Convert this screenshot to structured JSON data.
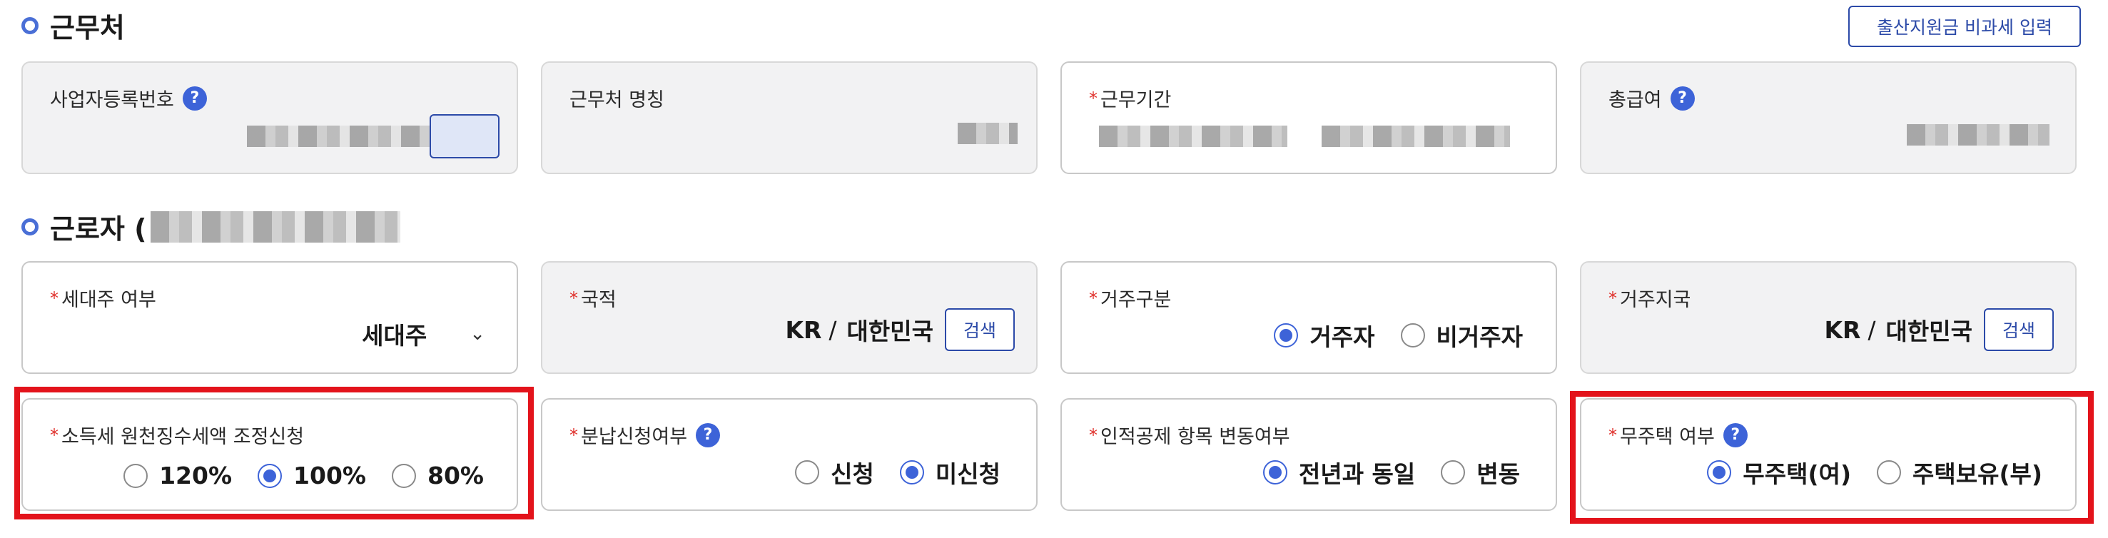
{
  "sections": {
    "workplace_title": "근무처",
    "worker_title": "근로자 ("
  },
  "top_button": "출산지원금 비과세 입력",
  "workplace": {
    "biz_no_label": "사업자등록번호",
    "name_label": "근무처 명칭",
    "period_label": "근무기간",
    "total_pay_label": "총급여"
  },
  "worker": {
    "householder": {
      "label": "세대주 여부",
      "value": "세대주"
    },
    "nationality": {
      "label": "국적",
      "code": "KR",
      "sep": "/",
      "name": "대한민국",
      "search": "검색"
    },
    "residency": {
      "label": "거주구분",
      "options": [
        "거주자",
        "비거주자"
      ],
      "selected": 0
    },
    "residence_country": {
      "label": "거주지국",
      "code": "KR",
      "sep": "/",
      "name": "대한민국",
      "search": "검색"
    },
    "withholding": {
      "label": "소득세 원천징수세액 조정신청",
      "options": [
        "120%",
        "100%",
        "80%"
      ],
      "selected": 1
    },
    "installment": {
      "label": "분납신청여부",
      "options": [
        "신청",
        "미신청"
      ],
      "selected": 1
    },
    "deduction_change": {
      "label": "인적공제 항목 변동여부",
      "options": [
        "전년과 동일",
        "변동"
      ],
      "selected": 0
    },
    "homeless": {
      "label": "무주택 여부",
      "options": [
        "무주택(여)",
        "주택보유(부)"
      ],
      "selected": 0
    }
  },
  "colors": {
    "accent": "#3d63d8",
    "highlight": "#e3131b",
    "required": "#e0322d"
  }
}
